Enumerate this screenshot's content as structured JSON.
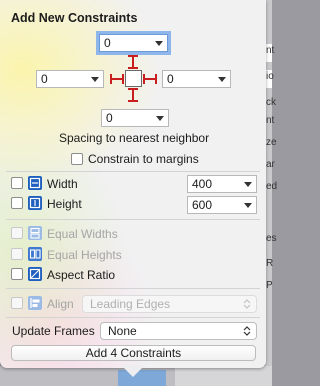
{
  "popover": {
    "title": "Add New Constraints",
    "spacing": {
      "top": "0",
      "left": "0",
      "right": "0",
      "bottom": "0",
      "caption": "Spacing to nearest neighbor",
      "constrain_to_margins": "Constrain to margins"
    },
    "size": {
      "width_label": "Width",
      "width_value": "400",
      "height_label": "Height",
      "height_value": "600"
    },
    "relations": {
      "equal_widths": "Equal Widths",
      "equal_heights": "Equal Heights",
      "aspect_ratio": "Aspect Ratio"
    },
    "align": {
      "label": "Align",
      "value": "Leading Edges"
    },
    "update_frames": {
      "label": "Update Frames",
      "value": "None"
    },
    "add_button": "Add 4 Constraints"
  },
  "colors": {
    "accent": "#1f5fbf",
    "constraint_line": "#c81e1e",
    "focus_ring": "#8fb6ea"
  },
  "background_text": [
    "nt",
    "io",
    "ck",
    "nt",
    "ze",
    "ar",
    "ed",
    "es",
    "R",
    "P"
  ]
}
